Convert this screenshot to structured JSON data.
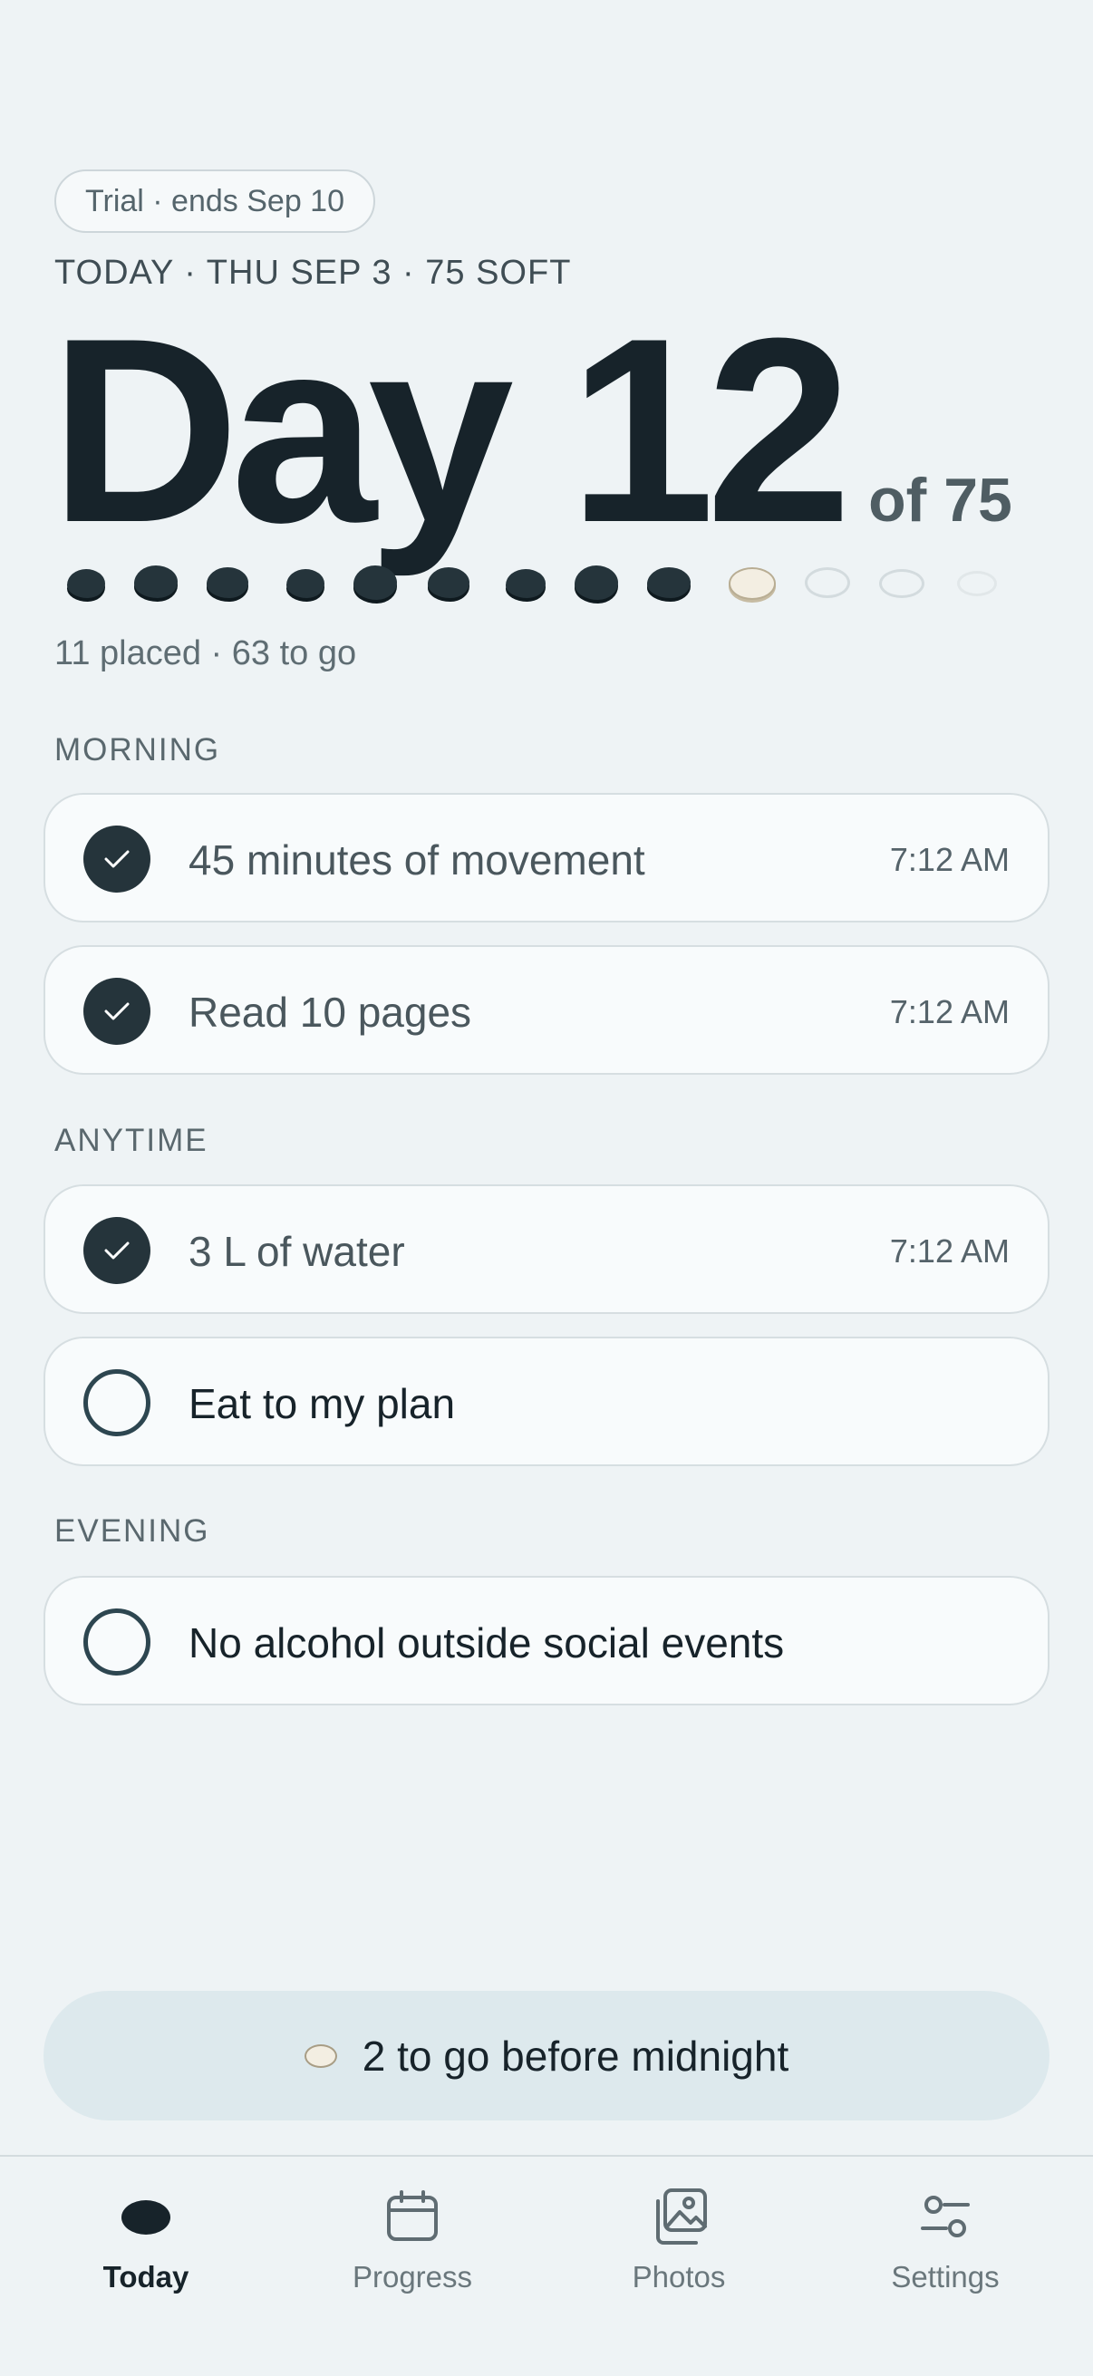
{
  "header": {
    "trial_badge": "Trial · ends Sep 10",
    "today_line": "TODAY · THU SEP 3 · 75 SOFT",
    "day_title": "Day 12",
    "day_of": "of 75"
  },
  "progress": {
    "placed_text": "11 placed · 63 to go",
    "visible_stones": [
      "done",
      "done",
      "done",
      "done",
      "done",
      "done",
      "done",
      "done",
      "done",
      "today",
      "future",
      "future",
      "future-faint"
    ]
  },
  "sections": [
    {
      "label": "MORNING",
      "tasks": [
        {
          "label": "45 minutes of movement",
          "done": true,
          "time": "7:12 AM"
        },
        {
          "label": "Read 10 pages",
          "done": true,
          "time": "7:12 AM"
        }
      ]
    },
    {
      "label": "ANYTIME",
      "tasks": [
        {
          "label": "3 L of water",
          "done": true,
          "time": "7:12 AM"
        },
        {
          "label": "Eat to my plan",
          "done": false,
          "time": ""
        }
      ]
    },
    {
      "label": "EVENING",
      "tasks": [
        {
          "label": "No alcohol outside social events",
          "done": false,
          "time": ""
        }
      ]
    }
  ],
  "cta": {
    "label": "2 to go before midnight"
  },
  "tabs": [
    {
      "label": "Today",
      "icon": "stone-icon",
      "active": true
    },
    {
      "label": "Progress",
      "icon": "calendar-icon",
      "active": false
    },
    {
      "label": "Photos",
      "icon": "photos-icon",
      "active": false
    },
    {
      "label": "Settings",
      "icon": "sliders-icon",
      "active": false
    }
  ],
  "colors": {
    "background": "#eef3f5",
    "ink": "#17232a",
    "stone_done": "#25343b",
    "card": "#f8fbfc",
    "cta": "#dde9ed"
  }
}
